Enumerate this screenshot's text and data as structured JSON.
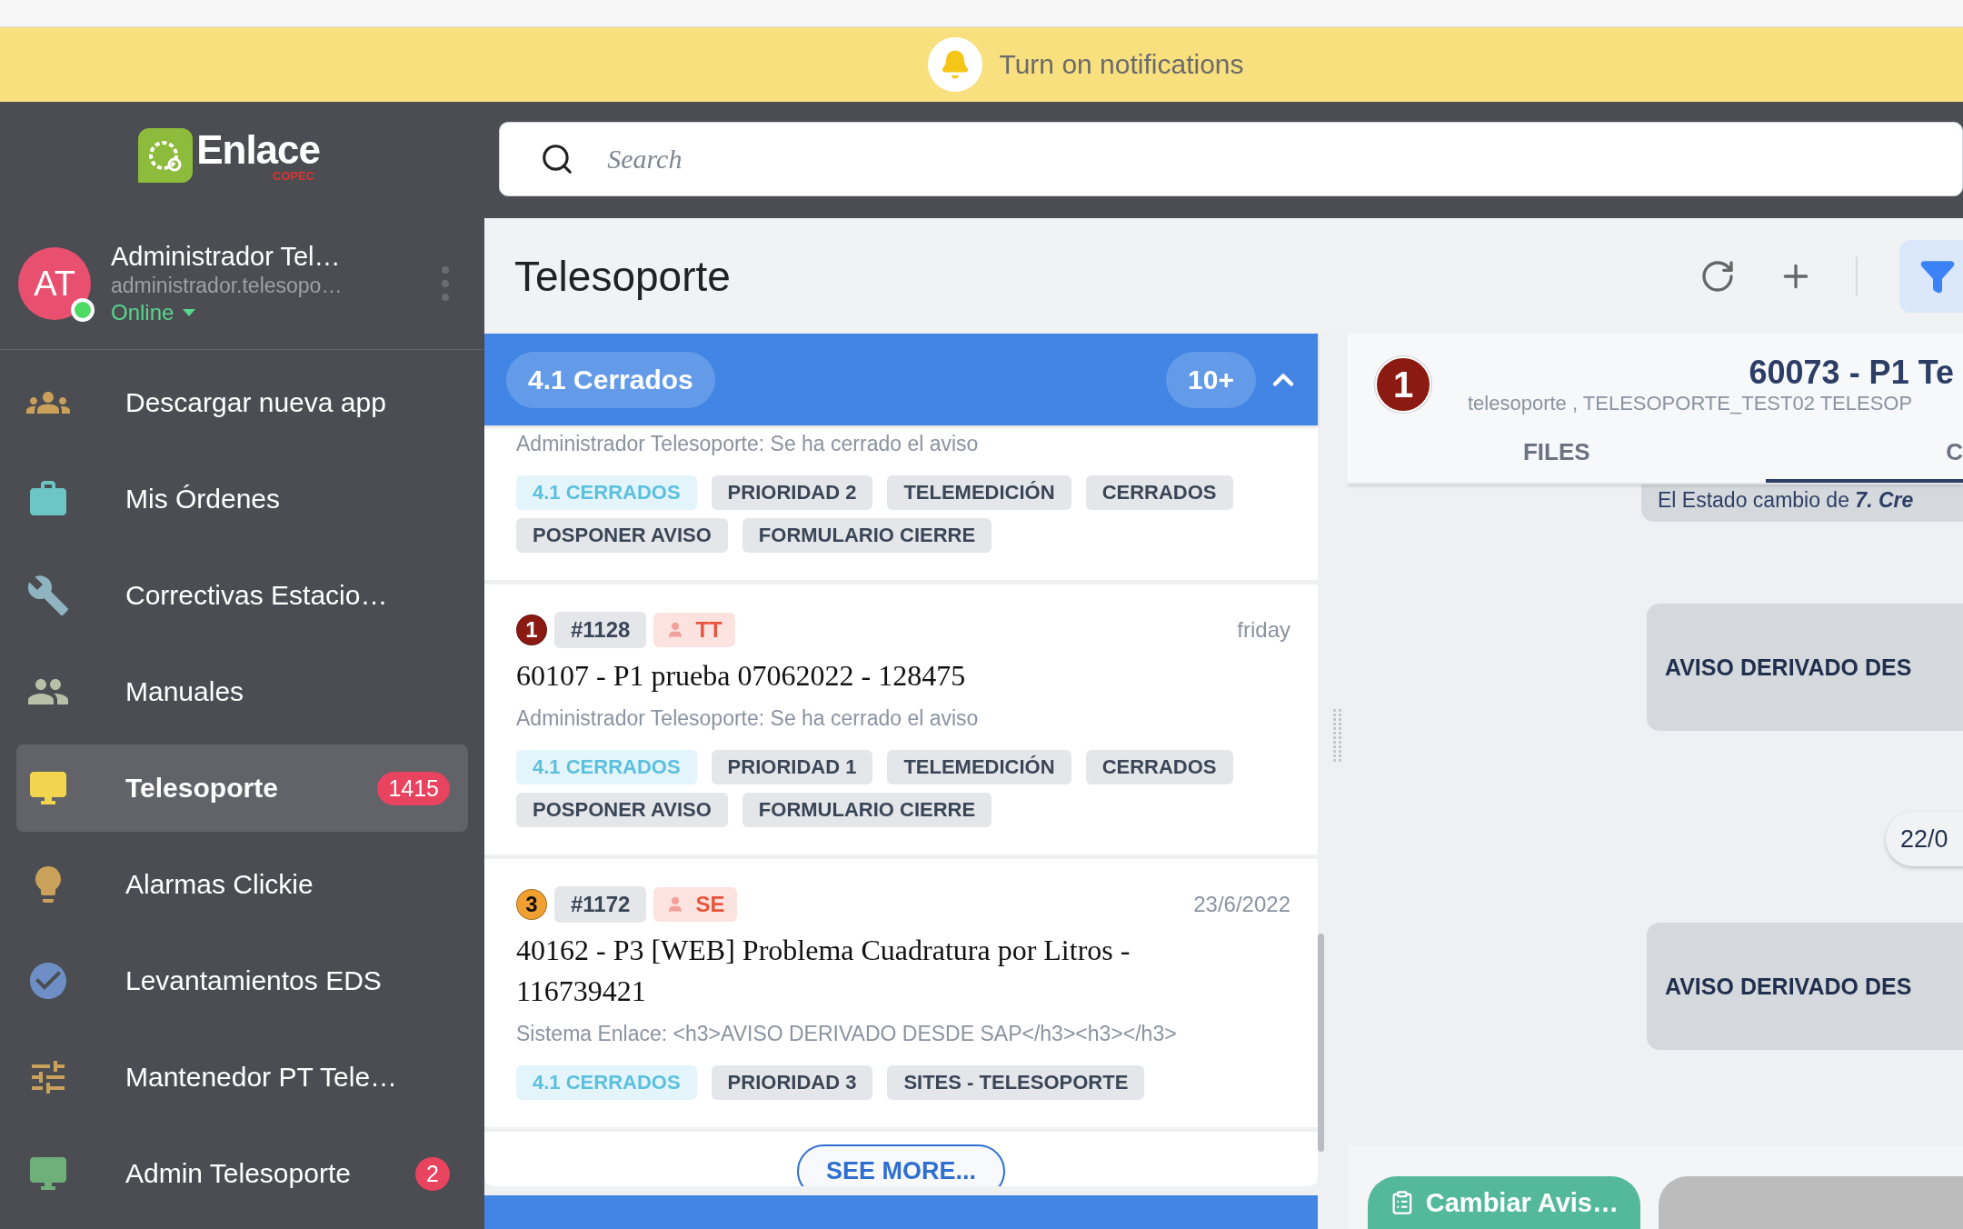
{
  "notification_bar": {
    "text": "Turn on notifications"
  },
  "logo": {
    "name": "Enlace",
    "sub": "COPEC"
  },
  "search": {
    "placeholder": "Search"
  },
  "user": {
    "initials": "AT",
    "name": "Administrador Tel…",
    "email": "administrador.telesopo…",
    "status": "Online",
    "online": true
  },
  "sidebar": {
    "items": [
      {
        "label": "Descargar nueva app",
        "selected": false
      },
      {
        "label": "Mis Órdenes",
        "selected": false
      },
      {
        "label": "Correctivas Estacio…",
        "selected": false
      },
      {
        "label": "Manuales",
        "selected": false
      },
      {
        "label": "Telesoporte",
        "selected": true,
        "badge": "1415"
      },
      {
        "label": "Alarmas Clickie",
        "selected": false
      },
      {
        "label": "Levantamientos EDS",
        "selected": false
      },
      {
        "label": "Mantenedor PT Tele…",
        "selected": false
      },
      {
        "label": "Admin Telesoporte",
        "selected": false,
        "badge": "2"
      }
    ]
  },
  "page": {
    "title": "Telesoporte",
    "filter_active": true
  },
  "group": {
    "title": "4.1 Cerrados",
    "count": "10+",
    "expanded": true
  },
  "cards": [
    {
      "preview": "Administrador Telesoporte: Se ha cerrado el aviso",
      "tags": [
        {
          "text": "4.1 CERRADOS",
          "kind": "status"
        },
        {
          "text": "PRIORIDAD 2",
          "kind": "label"
        },
        {
          "text": "TELEMEDICIÓN",
          "kind": "label"
        },
        {
          "text": "CERRADOS",
          "kind": "label"
        },
        {
          "text": "POSPONER AVISO",
          "kind": "label"
        },
        {
          "text": "FORMULARIO CIERRE",
          "kind": "label"
        }
      ]
    },
    {
      "priority": "1",
      "color": "#8b1a12",
      "number": "#1128",
      "assignee": "TT",
      "date": "friday",
      "title": "60107 - P1 prueba 07062022 - 128475",
      "preview": "Administrador Telesoporte: Se ha cerrado el aviso",
      "tags": [
        {
          "text": "4.1 CERRADOS",
          "kind": "status"
        },
        {
          "text": "PRIORIDAD 1",
          "kind": "label"
        },
        {
          "text": "TELEMEDICIÓN",
          "kind": "label"
        },
        {
          "text": "CERRADOS",
          "kind": "label"
        },
        {
          "text": "POSPONER AVISO",
          "kind": "label"
        },
        {
          "text": "FORMULARIO CIERRE",
          "kind": "label"
        }
      ]
    },
    {
      "priority": "3",
      "color": "#f0a030",
      "number": "#1172",
      "assignee": "SE",
      "date": "23/6/2022",
      "title": "40162 - P3 [WEB] Problema Cuadratura por Litros - 116739421",
      "preview": "Sistema Enlace: <h3>AVISO DERIVADO DESDE SAP</h3><h3></h3>",
      "tags": [
        {
          "text": "4.1 CERRADOS",
          "kind": "status"
        },
        {
          "text": "PRIORIDAD 3",
          "kind": "label"
        },
        {
          "text": "SITES - TELESOPORTE",
          "kind": "label"
        }
      ]
    }
  ],
  "see_more": "SEE MORE...",
  "detail": {
    "priority": "1",
    "color": "#8b1a12",
    "title": "60073 - P1 Te",
    "subtitle": "telesoporte , TELESOPORTE_TEST02 TELESOP",
    "tabs": [
      {
        "label": "FILES",
        "selected": false
      },
      {
        "label": "C",
        "selected": true
      }
    ],
    "messages": [
      {
        "kind": "event",
        "text": "El Estado cambio de **7. Cre**"
      },
      {
        "kind": "bubble",
        "text": "AVISO DERIVADO DES"
      },
      {
        "kind": "date",
        "text": "22/0"
      },
      {
        "kind": "bubble",
        "text": "AVISO DERIVADO DES"
      }
    ],
    "actions": [
      {
        "kind": "primary",
        "label": "Cambiar Avis…"
      },
      {
        "kind": "secondary"
      }
    ]
  }
}
